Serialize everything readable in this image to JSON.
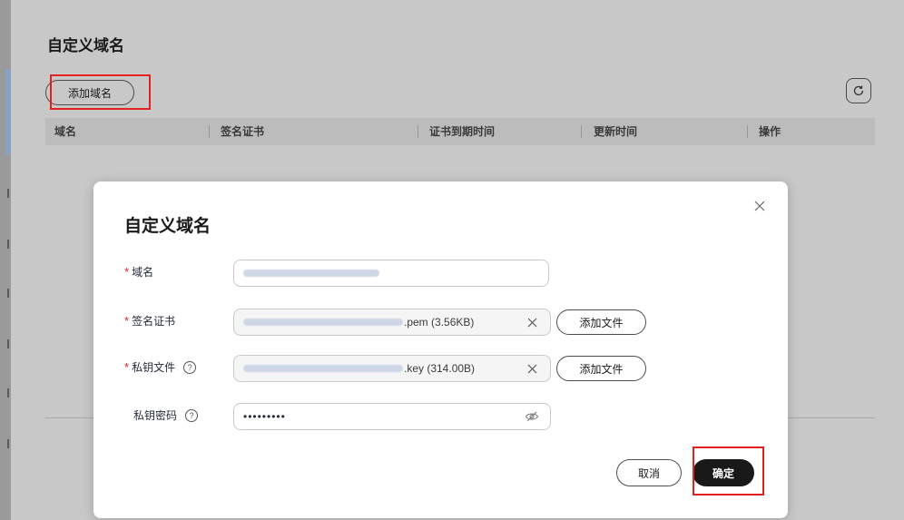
{
  "page": {
    "title": "自定义域名",
    "add_domain_label": "添加域名",
    "table_headers": [
      "域名",
      "签名证书",
      "证书到期时间",
      "更新时间",
      "操作"
    ]
  },
  "dialog": {
    "title": "自定义域名",
    "fields": {
      "domain": {
        "label": "域名",
        "required": true,
        "value": "test.myhuaweicloud.com"
      },
      "certificate": {
        "label": "签名证书",
        "required": true,
        "file_suffix": ".pem (3.56KB)",
        "button": "添加文件"
      },
      "private_key": {
        "label": "私钥文件",
        "required": true,
        "file_suffix": ".key (314.00B)",
        "button": "添加文件"
      },
      "key_password": {
        "label": "私钥密码",
        "required": false,
        "value": "•••••••••"
      }
    },
    "cancel_label": "取消",
    "confirm_label": "确定"
  },
  "colors": {
    "highlight": "#e52020",
    "confirm_bg": "#191919",
    "required": "#e52020"
  },
  "icons": [
    "refresh-icon",
    "close-icon",
    "clear-icon",
    "help-icon",
    "eye-off-icon"
  ]
}
